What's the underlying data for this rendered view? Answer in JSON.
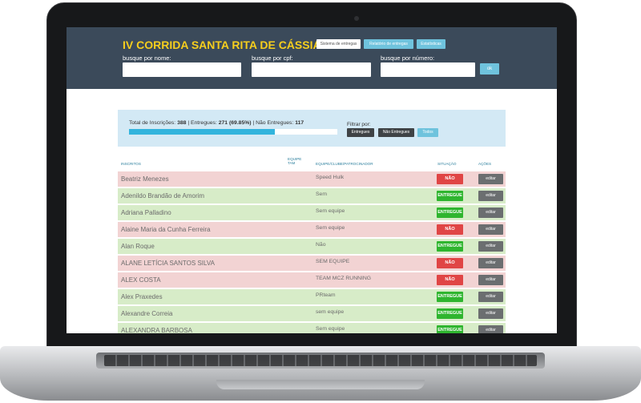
{
  "app": {
    "title": "IV CORRIDA SANTA RITA DE CÁSSIA",
    "nav": [
      {
        "label": "Sistema de entregas",
        "state": "active"
      },
      {
        "label": "Relatório de entregas",
        "state": "default"
      },
      {
        "label": "Estatísticas",
        "state": "default"
      }
    ],
    "search": {
      "name_label": "busque por nome:",
      "cpf_label": "busque por cpf:",
      "number_label": "busque por número:",
      "ok_label": "ok"
    }
  },
  "summary": {
    "total_label": "Total de Inscrições:",
    "total": "388",
    "delivered_label": "Entregues:",
    "delivered": "271 (69.85%)",
    "pending_label": "Não Entregues:",
    "pending": "117",
    "progress_fraction": 0.6985,
    "filter_label": "Filtrar por:",
    "filters": [
      "Entregues",
      "Não Entregues",
      "Todos"
    ]
  },
  "table": {
    "headers": {
      "name": "INSCRITOS",
      "size": "EQUIPE TAM",
      "team": "EQUIPE/CLUBE/PATROCINADOR",
      "status": "SITUAÇÃO",
      "actions": "AÇÕES"
    },
    "rows": [
      {
        "name": "Beatriz Menezes",
        "team": "Speed Hulk",
        "status": "NÃO ENTREGUE",
        "state": "pending",
        "action": "editar"
      },
      {
        "name": "Adenildo Brandão de Amorim",
        "team": "Sem",
        "status": "ENTREGUE",
        "state": "delivered",
        "action": "editar"
      },
      {
        "name": "Adriana Palladino",
        "team": "Sem equipe",
        "status": "ENTREGUE",
        "state": "delivered",
        "action": "editar"
      },
      {
        "name": "Alaine Maria da Cunha Ferreira",
        "team": "Sem equipe",
        "status": "NÃO ENTREGUE",
        "state": "pending",
        "action": "editar"
      },
      {
        "name": "Alan Roque",
        "team": "Não",
        "status": "ENTREGUE",
        "state": "delivered",
        "action": "editar"
      },
      {
        "name": "ALANE LETÍCIA SANTOS SILVA",
        "team": "SEM EQUIPE",
        "status": "NÃO ENTREGUE",
        "state": "pending",
        "action": "editar"
      },
      {
        "name": "ALEX COSTA",
        "team": "TEAM MCZ RUNNING",
        "status": "NÃO ENTREGUE",
        "state": "pending",
        "action": "editar"
      },
      {
        "name": "Alex Praxedes",
        "team": "PRteam",
        "status": "ENTREGUE",
        "state": "delivered",
        "action": "editar"
      },
      {
        "name": "Alexandre Correia",
        "team": "sem equipe",
        "status": "ENTREGUE",
        "state": "delivered",
        "action": "editar"
      },
      {
        "name": "ALEXANDRA BARBOSA",
        "team": "Sem equipe",
        "status": "ENTREGUE",
        "state": "delivered",
        "action": "editar"
      }
    ]
  }
}
